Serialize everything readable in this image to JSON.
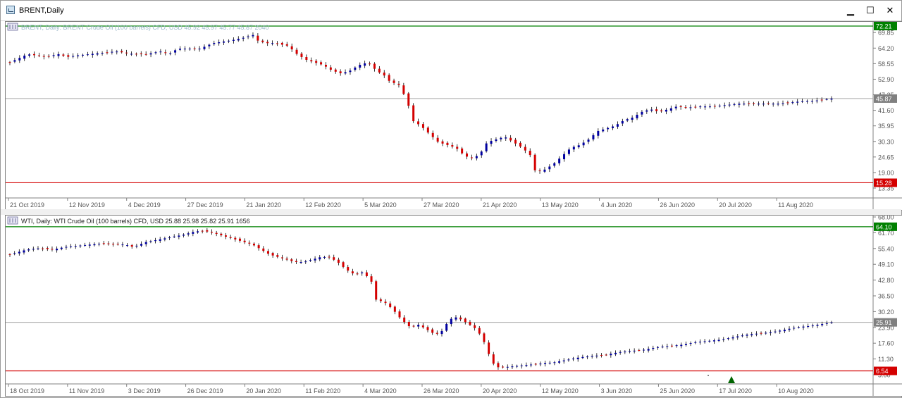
{
  "window": {
    "title": "BRENT,Daily",
    "icon": "chart-window-icon",
    "buttons": {
      "minimize": "▁",
      "maximize": "☐",
      "close": "✕"
    }
  },
  "chart_data": [
    {
      "type": "candlestick",
      "header": "BRENT, Daily:  BRENT Crude Oil (100 barrels) CFD, USD  45.92 45.97 45.77 45.87  2040",
      "y_ticks": [
        "69.85",
        "64.20",
        "58.55",
        "52.90",
        "47.25",
        "41.60",
        "35.95",
        "30.30",
        "24.65",
        "19.00",
        "13.35"
      ],
      "ylim": [
        13.35,
        72.21
      ],
      "x_ticks": [
        "21 Oct 2019",
        "12 Nov 2019",
        "4 Dec 2019",
        "27 Dec 2019",
        "21 Jan 2020",
        "12 Feb 2020",
        "5 Mar 2020",
        "27 Mar 2020",
        "21 Apr 2020",
        "13 May 2020",
        "4 Jun 2020",
        "26 Jun 2020",
        "20 Jul 2020",
        "11 Aug 2020"
      ],
      "levels": {
        "top": "72.21",
        "current": "45.87",
        "bottom": "15.28"
      },
      "colors": {
        "up": "#0000a0",
        "down": "#d40000",
        "top_line": "#008000",
        "bottom_line": "#d40000",
        "current_line": "#a9a9a9"
      },
      "close_path": [
        [
          0,
          59
        ],
        [
          8,
          62
        ],
        [
          16,
          61
        ],
        [
          22,
          62
        ],
        [
          26,
          61
        ],
        [
          30,
          61.5
        ],
        [
          36,
          62
        ],
        [
          42,
          62.5
        ],
        [
          48,
          63
        ],
        [
          56,
          62
        ],
        [
          62,
          62
        ],
        [
          68,
          63
        ],
        [
          72,
          62
        ],
        [
          76,
          64
        ],
        [
          82,
          64
        ],
        [
          86,
          64
        ],
        [
          92,
          66
        ],
        [
          100,
          67
        ],
        [
          106,
          68
        ],
        [
          110,
          69
        ],
        [
          112,
          67
        ],
        [
          116,
          66
        ],
        [
          120,
          66
        ],
        [
          126,
          65
        ],
        [
          130,
          62
        ],
        [
          134,
          60
        ],
        [
          138,
          59
        ],
        [
          142,
          58
        ],
        [
          146,
          56
        ],
        [
          150,
          55
        ],
        [
          154,
          56
        ],
        [
          158,
          58
        ],
        [
          162,
          59
        ],
        [
          166,
          56
        ],
        [
          170,
          54
        ],
        [
          172,
          52
        ],
        [
          176,
          51
        ],
        [
          180,
          45
        ],
        [
          182,
          38
        ],
        [
          186,
          36
        ],
        [
          190,
          33
        ],
        [
          194,
          30
        ],
        [
          198,
          29
        ],
        [
          202,
          28
        ],
        [
          206,
          25
        ],
        [
          210,
          24
        ],
        [
          214,
          27
        ],
        [
          216,
          30
        ],
        [
          220,
          31
        ],
        [
          224,
          32
        ],
        [
          228,
          30
        ],
        [
          232,
          28
        ],
        [
          236,
          25
        ],
        [
          238,
          19
        ],
        [
          242,
          20
        ],
        [
          246,
          22
        ],
        [
          250,
          25
        ],
        [
          254,
          28
        ],
        [
          258,
          29
        ],
        [
          262,
          31
        ],
        [
          266,
          34
        ],
        [
          270,
          35
        ],
        [
          274,
          36
        ],
        [
          278,
          38
        ],
        [
          282,
          39
        ],
        [
          286,
          41
        ],
        [
          290,
          42
        ],
        [
          294,
          41
        ],
        [
          298,
          42
        ],
        [
          302,
          43
        ],
        [
          306,
          42.5
        ],
        [
          312,
          43
        ],
        [
          318,
          43
        ],
        [
          324,
          43.5
        ],
        [
          330,
          44
        ],
        [
          336,
          44
        ],
        [
          342,
          44
        ],
        [
          348,
          44
        ],
        [
          354,
          44.5
        ],
        [
          360,
          45
        ],
        [
          364,
          45
        ],
        [
          368,
          45.5
        ],
        [
          372,
          45.87
        ]
      ],
      "x_domain": [
        0,
        372
      ]
    },
    {
      "type": "candlestick",
      "header": "WTI, Daily:  WTI Crude Oil (100 barrels) CFD, USD  25.88 25.98 25.82 25.91  1656",
      "y_ticks": [
        "68.00",
        "61.70",
        "55.40",
        "49.10",
        "42.80",
        "36.50",
        "30.20",
        "23.90",
        "17.60",
        "11.30",
        "5.00"
      ],
      "ylim": [
        5.0,
        68.0
      ],
      "x_ticks": [
        "18 Oct 2019",
        "11 Nov 2019",
        "3 Dec 2019",
        "26 Dec 2019",
        "20 Jan 2020",
        "11 Feb 2020",
        "4 Mar 2020",
        "26 Mar 2020",
        "20 Apr 2020",
        "12 May 2020",
        "3 Jun 2020",
        "25 Jun 2020",
        "17 Jul 2020",
        "10 Aug 2020"
      ],
      "levels": {
        "top": "64.10",
        "current": "25.91",
        "bottom": "6.54"
      },
      "colors": {
        "up": "#0000a0",
        "down": "#d40000",
        "top_line": "#008000",
        "bottom_line": "#d40000",
        "current_line": "#a9a9a9",
        "marker": "#006400"
      },
      "close_path": [
        [
          0,
          53
        ],
        [
          8,
          55
        ],
        [
          14,
          55.5
        ],
        [
          20,
          55
        ],
        [
          26,
          56
        ],
        [
          32,
          56.5
        ],
        [
          38,
          57
        ],
        [
          44,
          57.5
        ],
        [
          50,
          57
        ],
        [
          54,
          57
        ],
        [
          58,
          56
        ],
        [
          64,
          58
        ],
        [
          70,
          59
        ],
        [
          76,
          60
        ],
        [
          82,
          61
        ],
        [
          86,
          62
        ],
        [
          90,
          62.5
        ],
        [
          94,
          62
        ],
        [
          98,
          61
        ],
        [
          102,
          60
        ],
        [
          106,
          59
        ],
        [
          110,
          58
        ],
        [
          114,
          57
        ],
        [
          118,
          55
        ],
        [
          122,
          53
        ],
        [
          126,
          52
        ],
        [
          130,
          51
        ],
        [
          134,
          50
        ],
        [
          138,
          50
        ],
        [
          142,
          51
        ],
        [
          146,
          52
        ],
        [
          150,
          52
        ],
        [
          154,
          50
        ],
        [
          158,
          47
        ],
        [
          162,
          45
        ],
        [
          166,
          46
        ],
        [
          170,
          42
        ],
        [
          172,
          35
        ],
        [
          176,
          34
        ],
        [
          180,
          31
        ],
        [
          184,
          27
        ],
        [
          188,
          24
        ],
        [
          192,
          25
        ],
        [
          196,
          23
        ],
        [
          200,
          21
        ],
        [
          204,
          23
        ],
        [
          206,
          27
        ],
        [
          210,
          28
        ],
        [
          214,
          26
        ],
        [
          218,
          24
        ],
        [
          222,
          20
        ],
        [
          224,
          15
        ],
        [
          228,
          8
        ],
        [
          232,
          8
        ],
        [
          238,
          8.5
        ],
        [
          244,
          9
        ],
        [
          250,
          9.5
        ],
        [
          256,
          10
        ],
        [
          262,
          11
        ],
        [
          268,
          12
        ],
        [
          274,
          12.5
        ],
        [
          280,
          13
        ],
        [
          286,
          14
        ],
        [
          292,
          14.5
        ],
        [
          298,
          15
        ],
        [
          304,
          16
        ],
        [
          310,
          16.5
        ],
        [
          316,
          17
        ],
        [
          322,
          18
        ],
        [
          328,
          18.5
        ],
        [
          334,
          19
        ],
        [
          340,
          20
        ],
        [
          346,
          21
        ],
        [
          352,
          21.5
        ],
        [
          358,
          22
        ],
        [
          364,
          23
        ],
        [
          370,
          24
        ],
        [
          376,
          24.5
        ],
        [
          382,
          25.3
        ],
        [
          386,
          25.91
        ]
      ],
      "x_domain": [
        0,
        386
      ]
    }
  ]
}
